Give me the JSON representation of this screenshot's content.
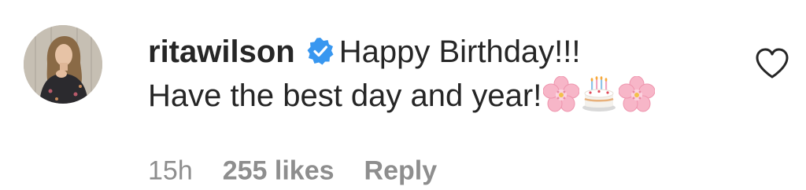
{
  "comment": {
    "avatar_icon": "profile-photo",
    "username": "ritawilson",
    "verified_icon": "verified-badge-icon",
    "verified_color": "#3897f0",
    "text_line1": "Happy Birthday!!!",
    "text_line2": "Have the best day and year!",
    "emojis": [
      "cherry-blossom",
      "birthday-cake",
      "cherry-blossom"
    ],
    "like_icon": "heart-outline-icon"
  },
  "meta": {
    "time": "15h",
    "likes": "255 likes",
    "reply": "Reply"
  }
}
